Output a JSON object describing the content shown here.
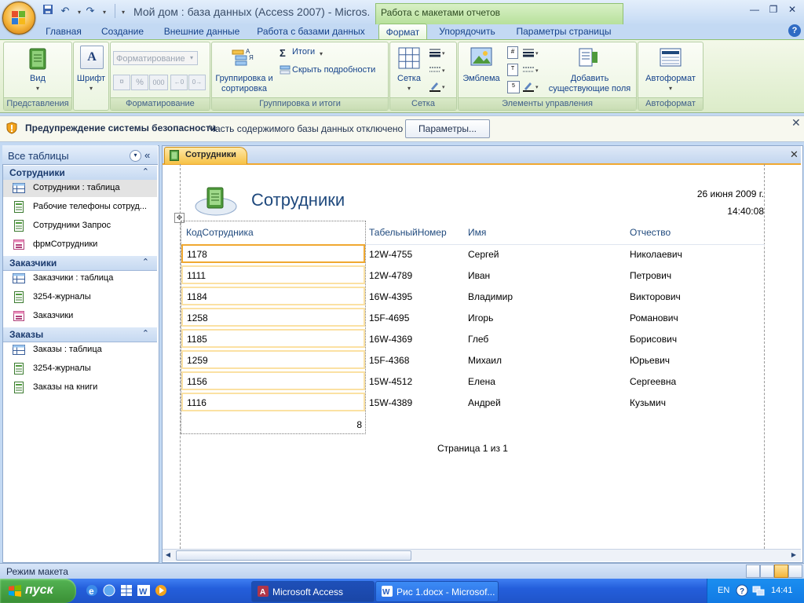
{
  "window": {
    "title": "Мой дом : база данных (Access 2007) - Micros...",
    "context_tab": "Работа с макетами отчетов"
  },
  "ribbon": {
    "tabs": [
      "Главная",
      "Создание",
      "Внешние данные",
      "Работа с базами данных",
      "Формат",
      "Упорядочить",
      "Параметры страницы"
    ],
    "active_tab": "Формат",
    "groups": {
      "views": {
        "label": "Представления",
        "view": "Вид"
      },
      "font": {
        "font": "Шрифт"
      },
      "formatting": {
        "label": "Форматирование",
        "dropdown": "Форматирование",
        "percent": "%",
        "thousands": "000"
      },
      "grouping": {
        "label": "Группировка и итоги",
        "group_sort": "Группировка и сортировка",
        "totals": "Итоги",
        "hide_details": "Скрыть подробности"
      },
      "grid": {
        "label": "Сетка",
        "grid": "Сетка"
      },
      "controls": {
        "label": "Элементы управления",
        "logo": "Эмблема",
        "add_fields": "Добавить существующие поля"
      },
      "autoformat": {
        "label": "Автоформат",
        "autoformat": "Автоформат"
      }
    }
  },
  "security": {
    "title": "Предупреждение системы безопасности",
    "text": "Часть содержимого базы данных отключено",
    "button": "Параметры..."
  },
  "nav": {
    "header": "Все таблицы",
    "groups": [
      {
        "name": "Сотрудники",
        "items": [
          "Сотрудники : таблица",
          "Рабочие телефоны сотруд...",
          "Сотрудники Запрос",
          "фрмСотрудники"
        ]
      },
      {
        "name": "Заказчики",
        "items": [
          "Заказчики : таблица",
          "3254-журналы",
          "Заказчики"
        ]
      },
      {
        "name": "Заказы",
        "items": [
          "Заказы : таблица",
          "3254-журналы",
          "Заказы на книги"
        ]
      }
    ]
  },
  "document": {
    "tab": "Сотрудники",
    "report_title": "Сотрудники",
    "date": "26 июня 2009 г.",
    "time": "14:40:08",
    "columns": [
      "КодСотрудника",
      "ТабельныйНомер",
      "Имя",
      "Отчество"
    ],
    "rows": [
      [
        "1178",
        "12W-4755",
        "Сергей",
        "Николаевич"
      ],
      [
        "1111",
        "12W-4789",
        "Иван",
        "Петрович"
      ],
      [
        "1184",
        "16W-4395",
        "Владимир",
        "Викторович"
      ],
      [
        "1258",
        "15F-4695",
        "Игорь",
        "Романович"
      ],
      [
        "1185",
        "16W-4369",
        "Глеб",
        "Борисович"
      ],
      [
        "1259",
        "15F-4368",
        "Михаил",
        "Юрьевич"
      ],
      [
        "1156",
        "15W-4512",
        "Елена",
        "Сергеевна"
      ],
      [
        "1116",
        "15W-4389",
        "Андрей",
        "Кузьмич"
      ]
    ],
    "total": "8",
    "page_info": "Страница 1 из 1"
  },
  "status": {
    "text": "Режим макета"
  },
  "taskbar": {
    "start": "пуск",
    "items": [
      "Microsoft Access",
      "Рис 1.docx - Microsof..."
    ],
    "lang": "EN",
    "clock": "14:41"
  }
}
